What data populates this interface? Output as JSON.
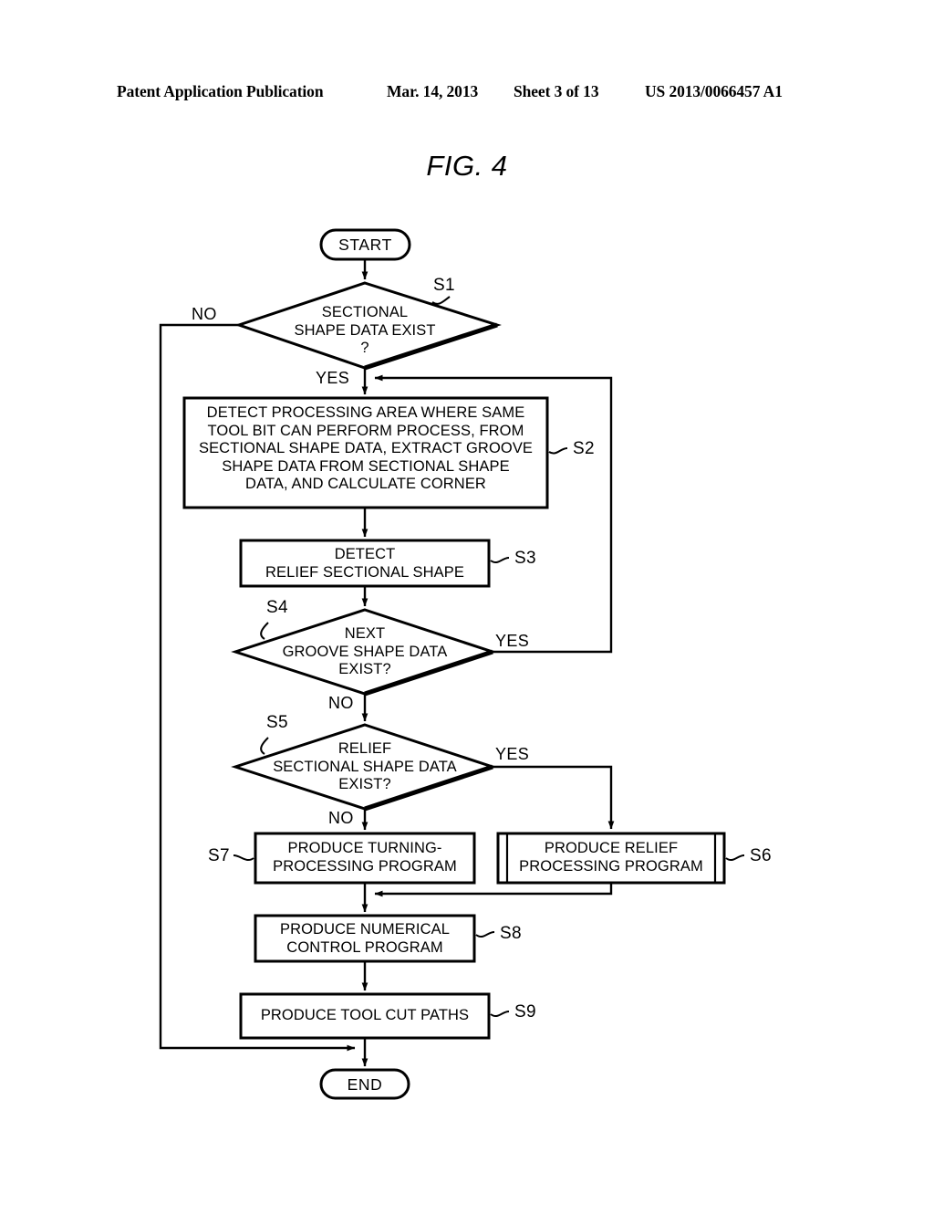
{
  "header": {
    "publication": "Patent Application Publication",
    "date": "Mar. 14, 2013",
    "sheet": "Sheet 3 of 13",
    "number": "US 2013/0066457 A1"
  },
  "figure": {
    "title": "FIG. 4"
  },
  "chart_data": {
    "type": "diagram",
    "diagram_kind": "flowchart",
    "title": "FIG. 4",
    "nodes": [
      {
        "id": "start",
        "shape": "terminator",
        "label": "START",
        "tag": ""
      },
      {
        "id": "s1",
        "shape": "decision",
        "label": "SECTIONAL\nSHAPE DATA EXIST\n?",
        "tag": "S1"
      },
      {
        "id": "s2",
        "shape": "process",
        "label": "DETECT PROCESSING AREA WHERE SAME\nTOOL BIT CAN PERFORM PROCESS, FROM\nSECTIONAL SHAPE DATA, EXTRACT GROOVE\nSHAPE DATA FROM SECTIONAL SHAPE\nDATA, AND CALCULATE CORNER",
        "tag": "S2"
      },
      {
        "id": "s3",
        "shape": "process",
        "label": "DETECT\nRELIEF SECTIONAL SHAPE",
        "tag": "S3"
      },
      {
        "id": "s4",
        "shape": "decision",
        "label": "NEXT\nGROOVE SHAPE DATA\nEXIST?",
        "tag": "S4"
      },
      {
        "id": "s5",
        "shape": "decision",
        "label": "RELIEF\nSECTIONAL SHAPE DATA\nEXIST?",
        "tag": "S5"
      },
      {
        "id": "s7",
        "shape": "process",
        "label": "PRODUCE TURNING-\nPROCESSING PROGRAM",
        "tag": "S7"
      },
      {
        "id": "s6",
        "shape": "predefined-process",
        "label": "PRODUCE RELIEF\nPROCESSING PROGRAM",
        "tag": "S6"
      },
      {
        "id": "s8",
        "shape": "process",
        "label": "PRODUCE NUMERICAL\nCONTROL PROGRAM",
        "tag": "S8"
      },
      {
        "id": "s9",
        "shape": "process",
        "label": "PRODUCE TOOL CUT PATHS",
        "tag": "S9"
      },
      {
        "id": "end",
        "shape": "terminator",
        "label": "END",
        "tag": ""
      }
    ],
    "edges": [
      {
        "from": "start",
        "to": "s1",
        "label": ""
      },
      {
        "from": "s1",
        "to": "end",
        "label": "NO"
      },
      {
        "from": "s1",
        "to": "s2",
        "label": "YES"
      },
      {
        "from": "s2",
        "to": "s3",
        "label": ""
      },
      {
        "from": "s3",
        "to": "s4",
        "label": ""
      },
      {
        "from": "s4",
        "to": "s2",
        "label": "YES"
      },
      {
        "from": "s4",
        "to": "s5",
        "label": "NO"
      },
      {
        "from": "s5",
        "to": "s6",
        "label": "YES"
      },
      {
        "from": "s5",
        "to": "s7",
        "label": "NO"
      },
      {
        "from": "s6",
        "to": "s8",
        "label": ""
      },
      {
        "from": "s7",
        "to": "s8",
        "label": ""
      },
      {
        "from": "s8",
        "to": "s9",
        "label": ""
      },
      {
        "from": "s9",
        "to": "end",
        "label": ""
      }
    ],
    "branch_labels": {
      "s1_no": "NO",
      "s1_yes": "YES",
      "s4_yes": "YES",
      "s4_no": "NO",
      "s5_yes": "YES",
      "s5_no": "NO"
    },
    "colors": {
      "line": "#000000",
      "background": "#ffffff"
    }
  }
}
